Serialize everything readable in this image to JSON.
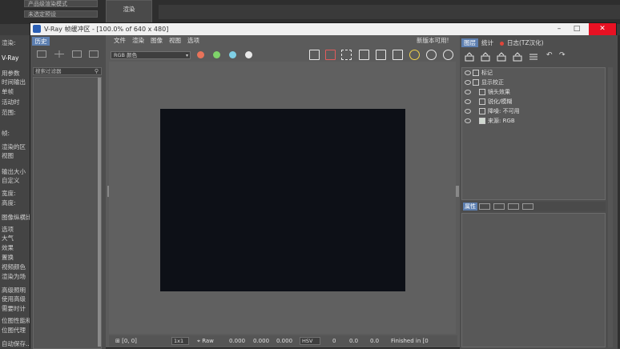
{
  "background": {
    "dropdown1": "产品级渲染模式",
    "dropdown2": "未选定预设",
    "render_button": "渲染",
    "left_labels": [
      "渲染:",
      "V-Ray",
      "用参数",
      "时间输出",
      "单帧",
      "活动时",
      "范围:",
      "帧:",
      "渲染的区",
      "视图",
      "输出大小",
      "自定义",
      "宽度:",
      "高度:",
      "图像纵横比",
      "选项",
      "大气",
      "效果",
      "置换",
      "视频颜色",
      "渲染为场",
      "高级照明",
      "使用高级",
      "需要时计",
      "位图性能和",
      "位图代理",
      "自动保存..."
    ]
  },
  "window": {
    "title": "V-Ray 帧缓冲区 - [100.0% of 640 x 480]",
    "minimize": "–",
    "maximize": "□",
    "close": "✕"
  },
  "history": {
    "tab": "历史",
    "filter_placeholder": "搜索过滤器",
    "filter_icon": "search-icon"
  },
  "menu": {
    "items": [
      "文件",
      "渲染",
      "图像",
      "视图",
      "选项"
    ],
    "update_notice": "新版本可用!"
  },
  "toolbar": {
    "channel": "RGB 颜色",
    "color_dots": [
      "#e8735a",
      "#7fd36a",
      "#7fd0e6",
      "#e8e8e8"
    ]
  },
  "status": {
    "coord": "[0, 0]",
    "zoom": "1x1",
    "raw": "Raw",
    "v1": "0.000",
    "v2": "0.000",
    "v3": "0.000",
    "mode": "HSV",
    "v4": "0",
    "v5": "0.0",
    "v6": "0.0",
    "finished": "Finished in [0"
  },
  "right_panel": {
    "tabs": [
      "图层",
      "统计",
      "日志(TZ汉化)"
    ],
    "layers": [
      {
        "label": "标记"
      },
      {
        "label": "显示校正"
      },
      {
        "label": "镜头效果"
      },
      {
        "label": "锐化/模糊"
      },
      {
        "label": "降噪: 不可用"
      },
      {
        "label": "来源: RGB"
      }
    ],
    "properties_tab": "属性"
  }
}
